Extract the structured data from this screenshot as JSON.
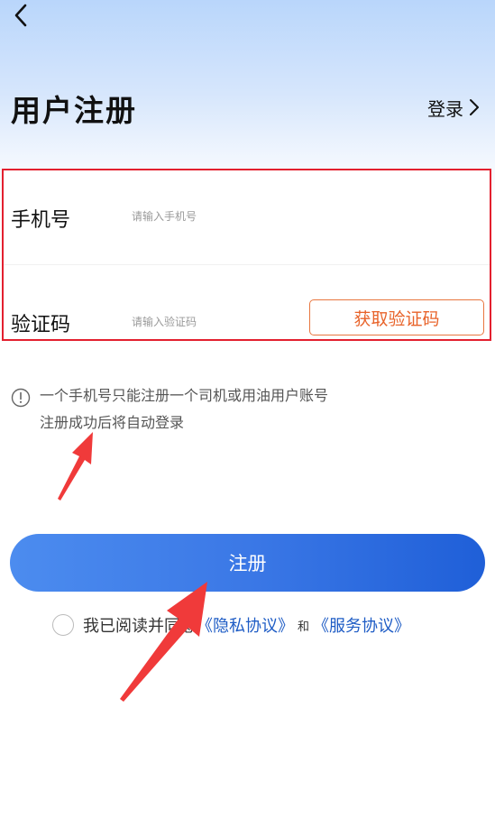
{
  "header": {
    "title": "用户注册",
    "login_label": "登录"
  },
  "form": {
    "phone": {
      "label": "手机号",
      "placeholder": "请输入手机号"
    },
    "code": {
      "label": "验证码",
      "placeholder": "请输入验证码",
      "button_label": "获取验证码"
    }
  },
  "notice": {
    "line1": "一个手机号只能注册一个司机或用油用户账号",
    "line2": "注册成功后将自动登录"
  },
  "register_button": "注册",
  "agreement": {
    "prefix": "我已阅读并同意",
    "privacy_link": "《隐私协议》",
    "and": "和",
    "service_link": "《服务协议》"
  },
  "colors": {
    "highlight_border": "#e3202f",
    "code_button": "#e8632a",
    "primary_blue": "#3b78e6",
    "link_blue": "#1e5cc5",
    "arrow_red": "#f03a3a"
  },
  "icons": {
    "back": "chevron-left-icon",
    "login_arrow": "chevron-right-icon",
    "notice": "info-circle-icon"
  }
}
